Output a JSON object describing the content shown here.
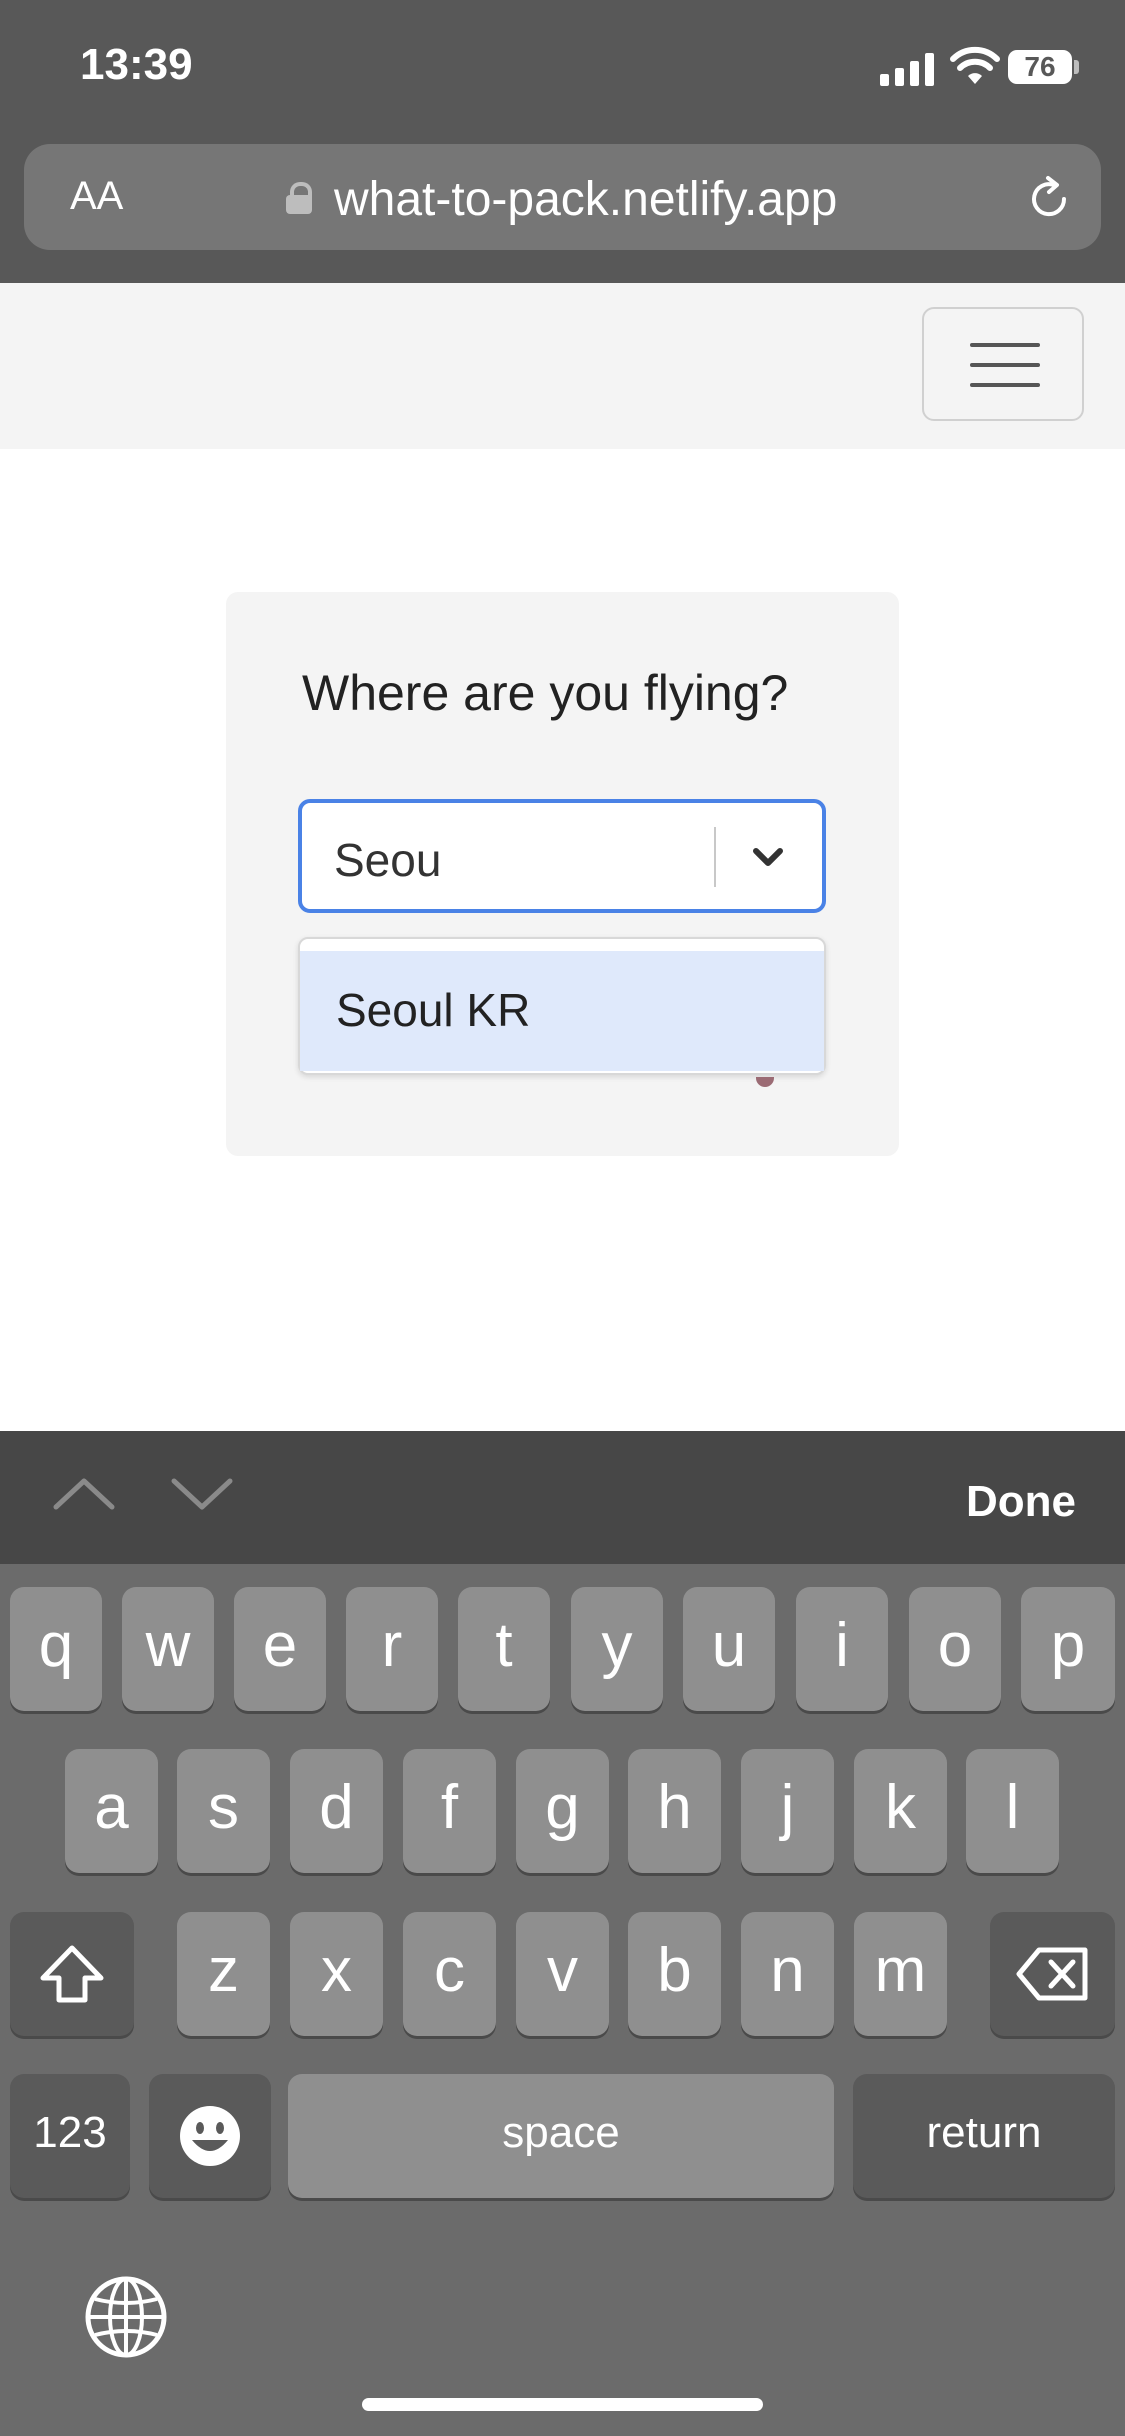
{
  "status_bar": {
    "time": "13:39",
    "battery": "76"
  },
  "browser": {
    "text_size_label": "AA",
    "url": "what-to-pack.netlify.app"
  },
  "card": {
    "title": "Where are you flying?",
    "select_value": "Seou",
    "options": [
      "Seoul KR"
    ]
  },
  "keyboard": {
    "done_label": "Done",
    "row1": [
      "q",
      "w",
      "e",
      "r",
      "t",
      "y",
      "u",
      "i",
      "o",
      "p"
    ],
    "row2": [
      "a",
      "s",
      "d",
      "f",
      "g",
      "h",
      "j",
      "k",
      "l"
    ],
    "row3": [
      "z",
      "x",
      "c",
      "v",
      "b",
      "n",
      "m"
    ],
    "numbers_label": "123",
    "space_label": "space",
    "return_label": "return"
  },
  "colors": {
    "focus_ring": "#4a82e6",
    "option_highlight": "#dfe9fb",
    "chrome": "#585858",
    "keyboard_bg": "#6b6b6b",
    "key": "#8f8f8f"
  },
  "icons": [
    "lock-icon",
    "reload-icon",
    "hamburger-icon",
    "chevron-down-icon",
    "chevron-up-icon",
    "shift-icon",
    "delete-icon",
    "emoji-icon",
    "globe-icon"
  ]
}
